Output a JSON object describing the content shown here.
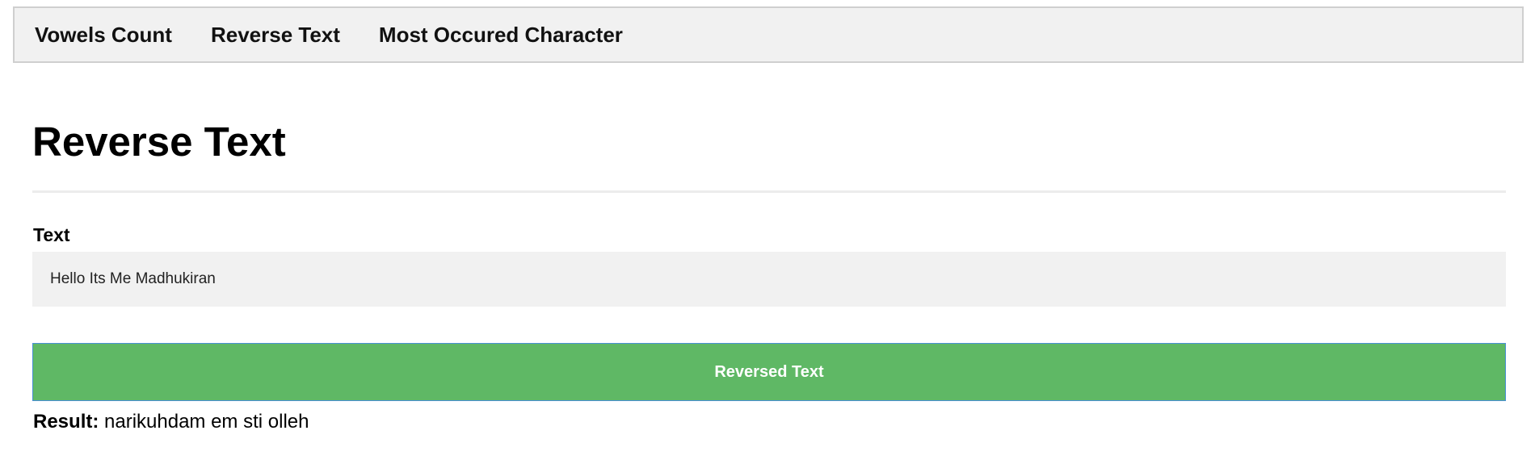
{
  "nav": {
    "items": [
      {
        "label": "Vowels Count"
      },
      {
        "label": "Reverse Text"
      },
      {
        "label": "Most Occured Character"
      }
    ]
  },
  "page": {
    "title": "Reverse Text"
  },
  "form": {
    "text_label": "Text",
    "text_value": "Hello Its Me Madhukiran",
    "submit_label": "Reversed Text"
  },
  "result": {
    "label": "Result:",
    "value": "narikuhdam em sti olleh"
  },
  "colors": {
    "navbar_background": "#f1f1f1",
    "button_background": "#5fb865",
    "button_text": "#ffffff",
    "input_background": "#f1f1f1"
  }
}
